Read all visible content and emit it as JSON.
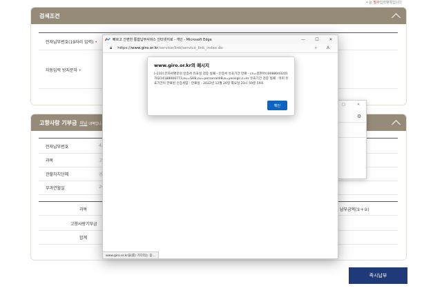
{
  "top_note": {
    "required_mark": "•",
    "required_text": "는 필수",
    "rest": "입력항목입니다"
  },
  "search_panel": {
    "title": "검색조건",
    "fields": [
      {
        "label": "전자납부번호(19자리 입력)",
        "required": "•"
      },
      {
        "label": "자동입력 방지문자",
        "required": "•"
      }
    ]
  },
  "detail_panel": {
    "title": "고향사랑 기부금",
    "title_sub": "미납",
    "title_sub2": "내역입니",
    "rows": [
      {
        "label": "전자납부번호",
        "value": "42"
      },
      {
        "label": "과목",
        "value": "고"
      },
      {
        "label": "관할자치단체",
        "value": "경"
      },
      {
        "label": "부과연월일",
        "value": "20"
      }
    ],
    "table_headers": {
      "col1": "과목",
      "col_last": "납부금액(①+②)"
    },
    "table_rows": [
      {
        "label": "고향사랑기부금"
      },
      {
        "label": "합계"
      }
    ]
  },
  "pay_button": "즉시납부",
  "edge_window": {
    "title": "빠르고 간편한 통합납부서비스 인터넷지로 - 개인 - Microsoft Edge",
    "url_prefix": "https://",
    "url_domain": "www.giro.or.kr",
    "url_path": "/service/link/service_link_index.do",
    "status": "www.giro.or.kr을(를) 기다리는 중..."
  },
  "alert": {
    "title": "www.giro.or.kr의 메시지",
    "message": "[-110] 전자서명문의 인증서 유효성 검증 실패 - 인증서 유효기간 만료 - cn=김현아()008804320170214188000773,ou=SHB,ou=personal4IB,o=yessign,c=kr 유효기간 검증 실패 : 이미 유효기간이 만료된 인증서임 : 만료일 - 2022년 12월 20일 화요일 23시 59분 59초",
    "ok_label": "확인"
  },
  "icons": {
    "logo": "edge-logo-icon",
    "lock": "lock-icon",
    "gear": "gear-icon"
  }
}
